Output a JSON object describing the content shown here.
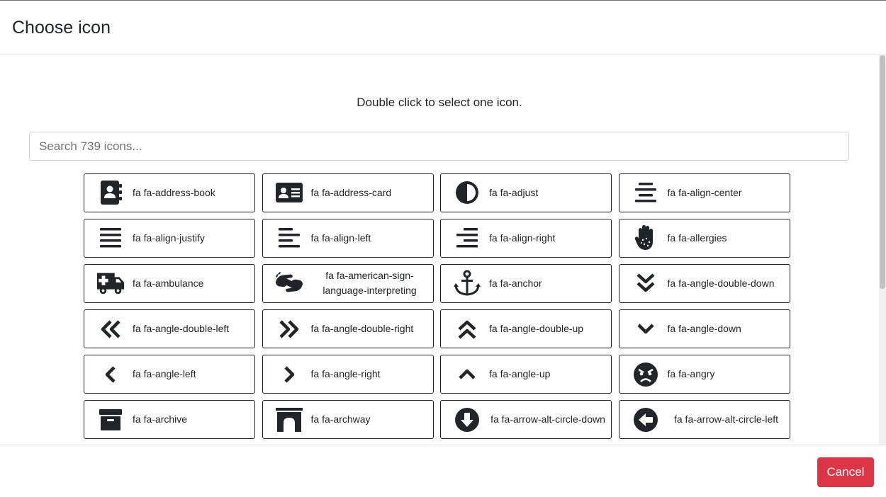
{
  "modal": {
    "title": "Choose icon",
    "instructions": "Double click to select one icon.",
    "search_placeholder": "Search 739 icons...",
    "cancel_label": "Cancel"
  },
  "icons": [
    {
      "label": "fa fa-address-book",
      "icon": "address-book-icon"
    },
    {
      "label": "fa fa-address-card",
      "icon": "address-card-icon"
    },
    {
      "label": "fa fa-adjust",
      "icon": "adjust-icon"
    },
    {
      "label": "fa fa-align-center",
      "icon": "align-center-icon"
    },
    {
      "label": "fa fa-align-justify",
      "icon": "align-justify-icon"
    },
    {
      "label": "fa fa-align-left",
      "icon": "align-left-icon"
    },
    {
      "label": "fa fa-align-right",
      "icon": "align-right-icon"
    },
    {
      "label": "fa fa-allergies",
      "icon": "allergies-icon"
    },
    {
      "label": "fa fa-ambulance",
      "icon": "ambulance-icon"
    },
    {
      "label": "fa fa-american-sign-language-interpreting",
      "icon": "american-sign-language-interpreting-icon"
    },
    {
      "label": "fa fa-anchor",
      "icon": "anchor-icon"
    },
    {
      "label": "fa fa-angle-double-down",
      "icon": "angle-double-down-icon"
    },
    {
      "label": "fa fa-angle-double-left",
      "icon": "angle-double-left-icon"
    },
    {
      "label": "fa fa-angle-double-right",
      "icon": "angle-double-right-icon"
    },
    {
      "label": "fa fa-angle-double-up",
      "icon": "angle-double-up-icon"
    },
    {
      "label": "fa fa-angle-down",
      "icon": "angle-down-icon"
    },
    {
      "label": "fa fa-angle-left",
      "icon": "angle-left-icon"
    },
    {
      "label": "fa fa-angle-right",
      "icon": "angle-right-icon"
    },
    {
      "label": "fa fa-angle-up",
      "icon": "angle-up-icon"
    },
    {
      "label": "fa fa-angry",
      "icon": "angry-icon"
    },
    {
      "label": "fa fa-archive",
      "icon": "archive-icon"
    },
    {
      "label": "fa fa-archway",
      "icon": "archway-icon"
    },
    {
      "label": "fa fa-arrow-alt-circle-down",
      "icon": "arrow-alt-circle-down-icon"
    },
    {
      "label": "fa fa-arrow-alt-circle-left",
      "icon": "arrow-alt-circle-left-icon"
    }
  ]
}
